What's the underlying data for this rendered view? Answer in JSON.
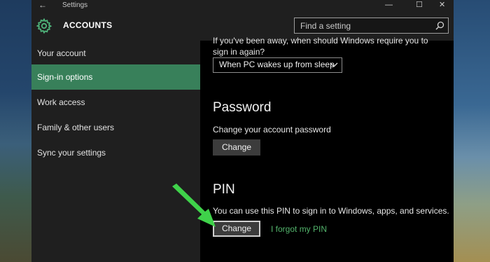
{
  "window": {
    "title": "Settings",
    "controls": {
      "back": "←",
      "minimize": "—",
      "maximize": "☐",
      "close": "✕"
    }
  },
  "header": {
    "title": "ACCOUNTS",
    "search_placeholder": "Find a setting"
  },
  "sidebar": {
    "items": [
      {
        "label": "Your account"
      },
      {
        "label": "Sign-in options"
      },
      {
        "label": "Work access"
      },
      {
        "label": "Family & other users"
      },
      {
        "label": "Sync your settings"
      }
    ],
    "active_index": 1
  },
  "content": {
    "require_signin_question": "If you've been away, when should Windows require you to sign in again?",
    "require_signin_value": "When PC wakes up from sleep",
    "password": {
      "heading": "Password",
      "description": "Change your account password",
      "button": "Change"
    },
    "pin": {
      "heading": "PIN",
      "description": "You can use this PIN to sign in to Windows, apps, and services.",
      "button": "Change",
      "forgot_link": "I forgot my PIN"
    }
  },
  "colors": {
    "accent": "#38805a",
    "link": "#52b36b",
    "annotation_arrow": "#3fd24a"
  }
}
